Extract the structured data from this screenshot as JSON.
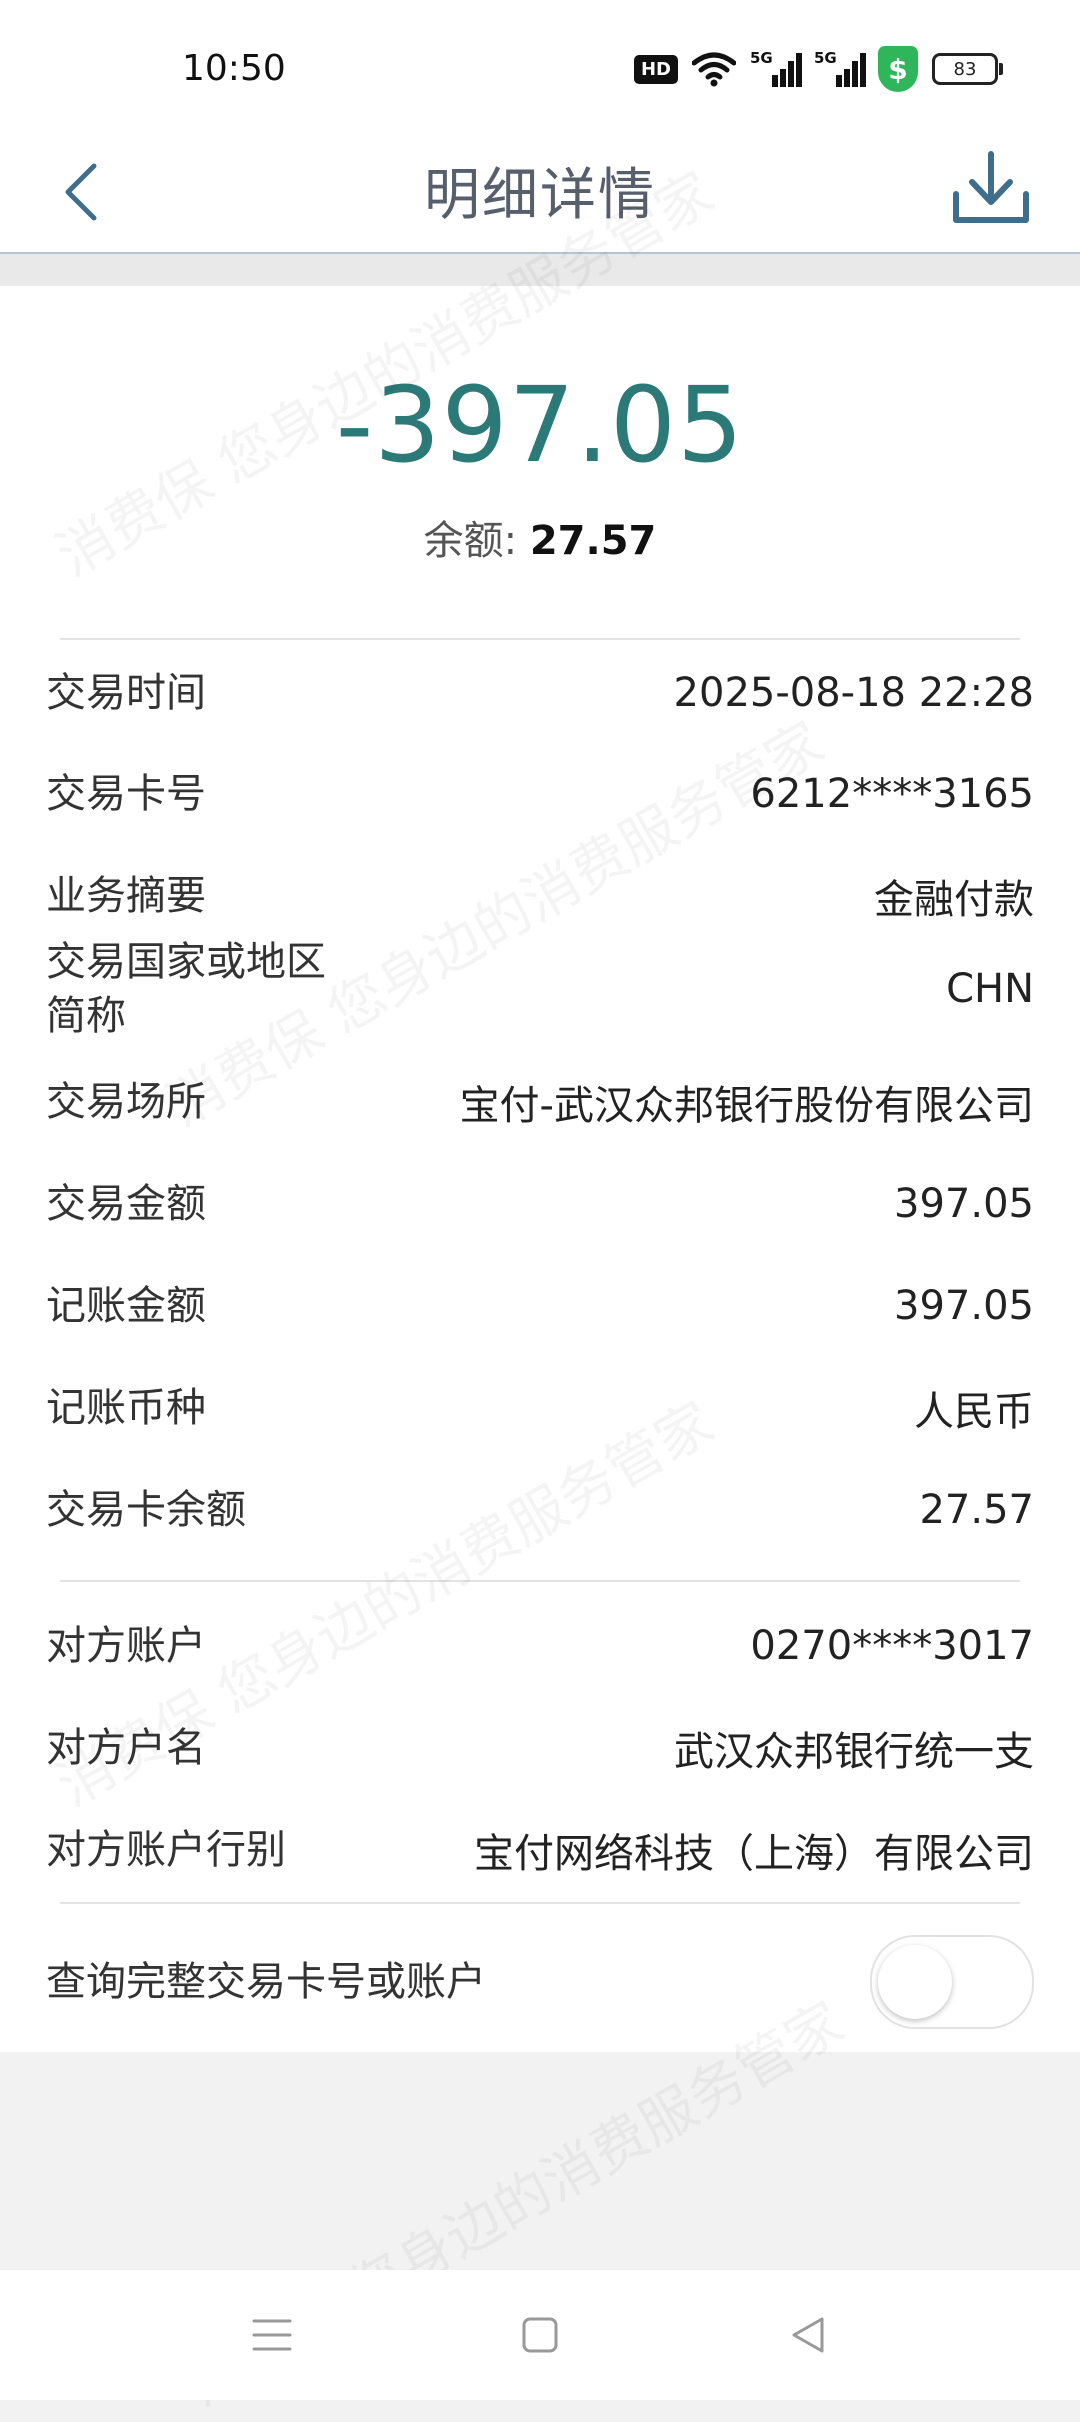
{
  "status_bar": {
    "time": "10:50",
    "hd_badge": "HD",
    "signal_1": "5G",
    "signal_2": "5G",
    "battery": "83",
    "shield_symbol": "$"
  },
  "header": {
    "title": "明细详情",
    "back_icon": "chevron-left-icon",
    "download_icon": "download-icon"
  },
  "summary": {
    "amount": "-397.05",
    "balance_label": "余额: ",
    "balance_value": "27.57",
    "amount_color": "#2c7a78"
  },
  "details": {
    "rows": [
      {
        "label": "交易时间",
        "value": "2025-08-18 22:28"
      },
      {
        "label": "交易卡号",
        "value": "6212****3165"
      },
      {
        "label": "业务摘要",
        "value": "金融付款"
      },
      {
        "label": "交易国家或地区\n简称",
        "value": "CHN"
      },
      {
        "label": "交易场所",
        "value": "宝付-武汉众邦银行股份有限公司"
      },
      {
        "label": "交易金额",
        "value": "397.05"
      },
      {
        "label": "记账金额",
        "value": "397.05"
      },
      {
        "label": "记账币种",
        "value": "人民币"
      },
      {
        "label": "交易卡余额",
        "value": "27.57"
      }
    ]
  },
  "counterparty": {
    "rows": [
      {
        "label": "对方账户",
        "value": "0270****3017"
      },
      {
        "label": "对方户名",
        "value": "武汉众邦银行统一支"
      },
      {
        "label": "对方账户行别",
        "value": "宝付网络科技（上海）有限公司"
      }
    ]
  },
  "query_full": {
    "label": "查询完整交易卡号或账户",
    "enabled": false
  },
  "watermark_text": "消费保 您身边的消费服务管家"
}
